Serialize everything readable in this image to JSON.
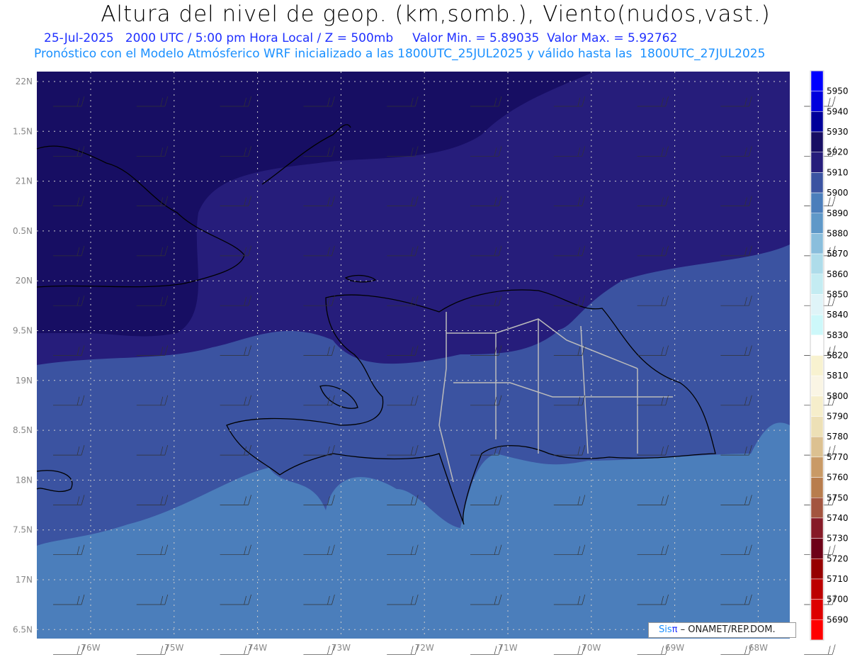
{
  "title": "Altura del nivel de geop. (km,somb.), Viento(nudos,vast.)",
  "subtitle": "25-Jul-2025   2000 UTC / 5:00 pm Hora Local / Z = 500mb     Valor Min. = 5.89035  Valor Max. = 5.92762",
  "model_line": "Pronóstico con el Modelo Atmósferico WRF inicializado a las 1800UTC_25JUL2025 y válido hasta las  1800UTC_27JUL2025",
  "lat_labels": [
    "22N",
    "1.5N",
    "21N",
    "0.5N",
    "20N",
    "9.5N",
    "19N",
    "8.5N",
    "18N",
    "7.5N",
    "17N",
    "6.5N"
  ],
  "lon_labels": [
    "76W",
    "75W",
    "74W",
    "73W",
    "72W",
    "71W",
    "70W",
    "69W",
    "68W"
  ],
  "colorbar": {
    "labels": [
      "5950",
      "5940",
      "5930",
      "5920",
      "5910",
      "5900",
      "5890",
      "5880",
      "5870",
      "5860",
      "5850",
      "5840",
      "5830",
      "5820",
      "5810",
      "5800",
      "5790",
      "5780",
      "5770",
      "5760",
      "5750",
      "5740",
      "5730",
      "5720",
      "5710",
      "5700",
      "5690"
    ],
    "colors": [
      "#0000ff",
      "#0000dd",
      "#00009a",
      "#170e63",
      "#261d7b",
      "#3b53a1",
      "#4b7ebb",
      "#5f98c8",
      "#8abedc",
      "#aedcea",
      "#c4ecf2",
      "#dff4f8",
      "#cdf8fa",
      "#ffffff",
      "#f8f2d0",
      "#faf5e4",
      "#f6eecb",
      "#ede0b6",
      "#dcc191",
      "#c99a66",
      "#b87d4d",
      "#a3553f",
      "#861a27",
      "#6d0017",
      "#960000",
      "#bc0000",
      "#dd0000",
      "#ff0000"
    ]
  },
  "logo": {
    "brand": "Sis",
    "pi": "π",
    "text": " –  ONAMET/REP.DOM."
  }
}
